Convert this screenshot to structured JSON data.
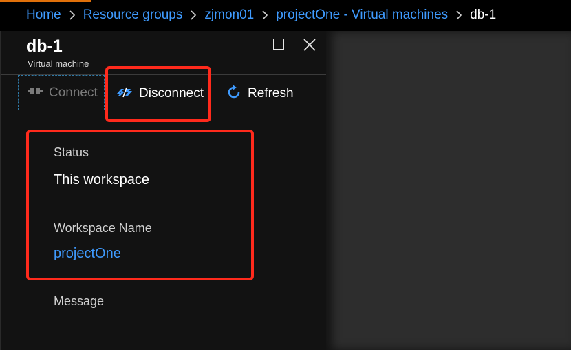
{
  "breadcrumb": {
    "items": [
      {
        "label": "Home"
      },
      {
        "label": "Resource groups"
      },
      {
        "label": "zjmon01"
      },
      {
        "label": "projectOne - Virtual machines"
      },
      {
        "label": "db-1"
      }
    ],
    "separator_icon": "chevron-right-icon"
  },
  "blade": {
    "title": "db-1",
    "subtitle": "Virtual machine",
    "maximize_icon": "maximize-icon",
    "close_icon": "close-icon"
  },
  "toolbar": {
    "connect_label": "Connect",
    "connect_icon": "plug-connect-icon",
    "connect_state": "disabled",
    "disconnect_label": "Disconnect",
    "disconnect_icon": "plug-disconnect-icon",
    "refresh_label": "Refresh",
    "refresh_icon": "refresh-icon"
  },
  "details": {
    "status_label": "Status",
    "status_value": "This workspace",
    "workspace_name_label": "Workspace Name",
    "workspace_name_value": "projectOne",
    "message_label": "Message"
  },
  "colors": {
    "accent_blue": "#3f9bff",
    "highlight_red": "#ff2a1c",
    "portal_orange": "#e0700a",
    "background": "#121212"
  }
}
